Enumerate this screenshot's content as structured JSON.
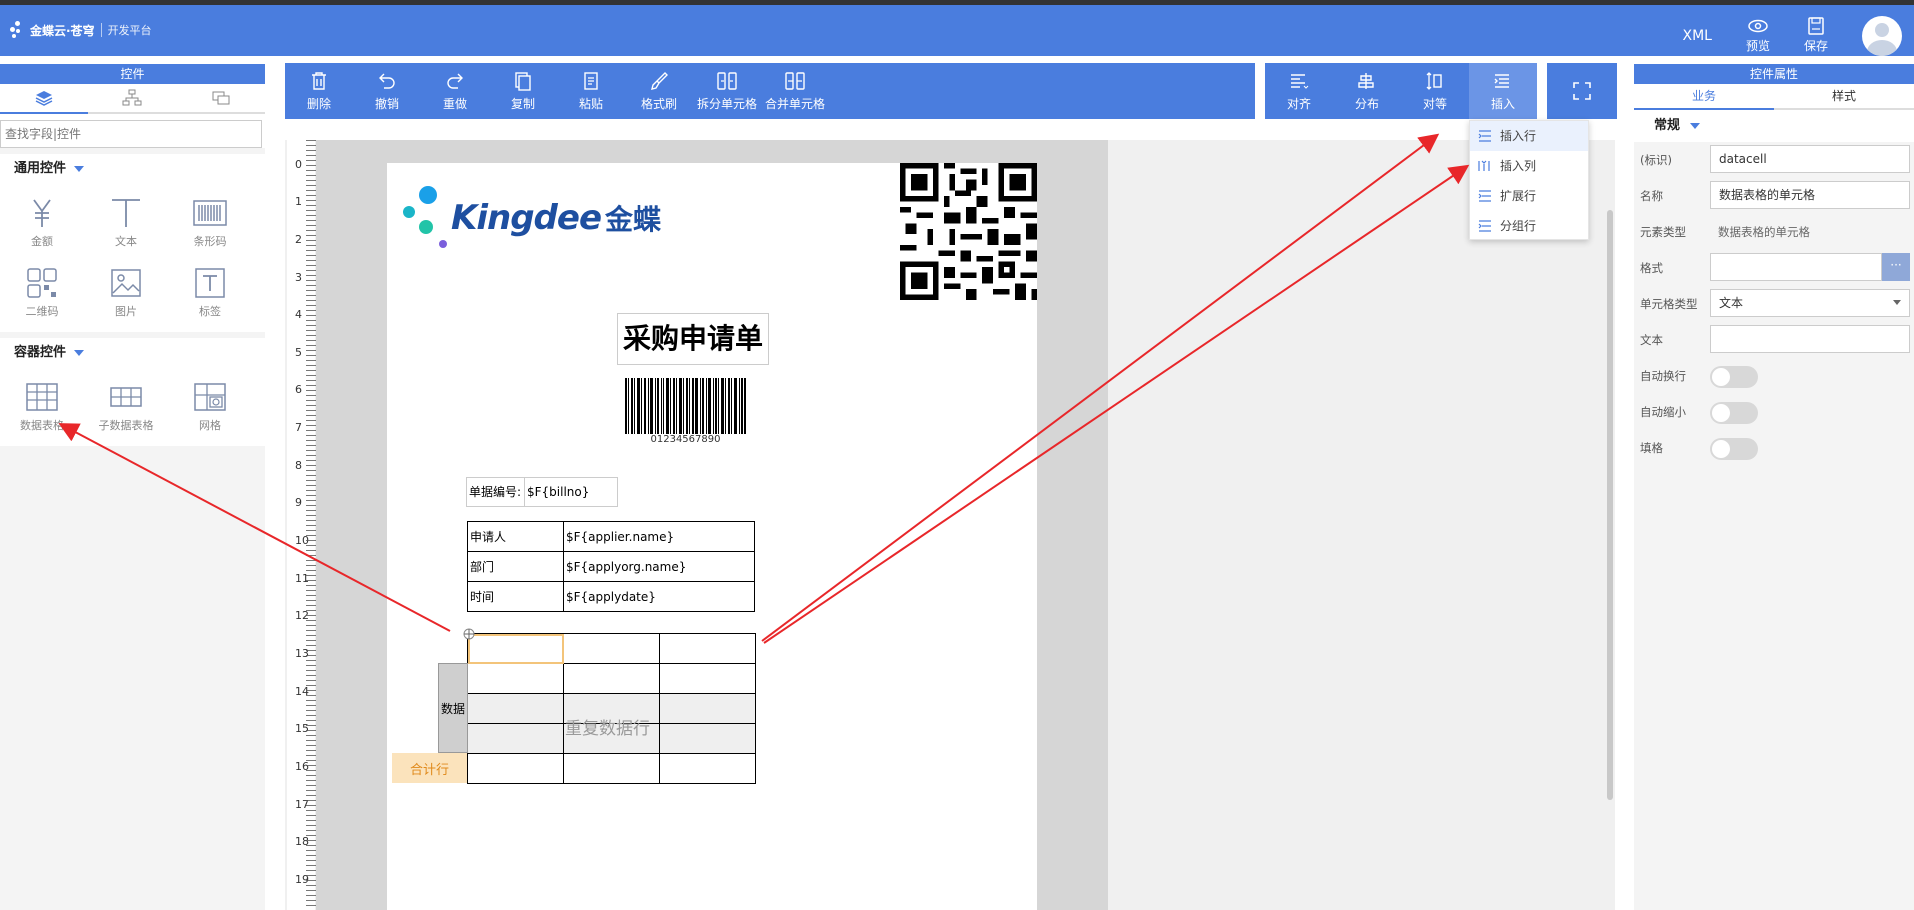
{
  "header": {
    "logo_name": "金蝶云·苍穹",
    "logo_sub": "开发平台",
    "xml_label": "XML",
    "preview_label": "预览",
    "save_label": "保存"
  },
  "left_panel": {
    "title": "控件",
    "search_placeholder": "查找字段|控件",
    "general_title": "通用控件",
    "general_items": [
      "金额",
      "文本",
      "条形码",
      "二维码",
      "图片",
      "标签"
    ],
    "container_title": "容器控件",
    "container_items": [
      "数据表格",
      "子数据表格",
      "网格"
    ]
  },
  "toolbar": {
    "items": [
      "删除",
      "撤销",
      "重做",
      "复制",
      "粘贴",
      "格式刷",
      "拆分单元格",
      "合并单元格"
    ],
    "right_items": [
      "对齐",
      "分布",
      "对等",
      "插入"
    ]
  },
  "insert_menu": [
    "插入行",
    "插入列",
    "扩展行",
    "分组行"
  ],
  "ruler": [
    "0",
    "1",
    "2",
    "3",
    "4",
    "5",
    "6",
    "7",
    "8",
    "9",
    "10",
    "11",
    "12",
    "13",
    "14",
    "15",
    "16",
    "17",
    "18",
    "19"
  ],
  "document": {
    "brand": "Kingdee",
    "brand_cn": "金蝶",
    "title": "采购申请单",
    "barcode_text": "01234567890",
    "billno_label": "单据编号:",
    "billno_value": "$F{billno}",
    "info_rows": [
      {
        "label": "申请人",
        "value": "$F{applier.name}"
      },
      {
        "label": "部门",
        "value": "$F{applyorg.name}"
      },
      {
        "label": "时间",
        "value": "$F{applydate}"
      }
    ],
    "data_label": "数据",
    "repeat_text": "重复数据行",
    "total_label": "合计行"
  },
  "right_panel": {
    "title": "控件属性",
    "tab_business": "业务",
    "tab_style": "样式",
    "section": "常规",
    "id_label": "(标识)",
    "id_value": "datacell",
    "name_label": "名称",
    "name_value": "数据表格的单元格",
    "type_label": "元素类型",
    "type_value": "数据表格的单元格",
    "format_label": "格式",
    "format_more": "···",
    "celltype_label": "单元格类型",
    "celltype_value": "文本",
    "text_label": "文本",
    "text_value": "",
    "autowrap_label": "自动换行",
    "autoshrink_label": "自动缩小",
    "fill_label": "填格"
  },
  "colors": {
    "primary": "#4a7dde",
    "arrow": "#e8272a",
    "selection": "#f3c47a",
    "total_bg": "#fbe3bc"
  }
}
